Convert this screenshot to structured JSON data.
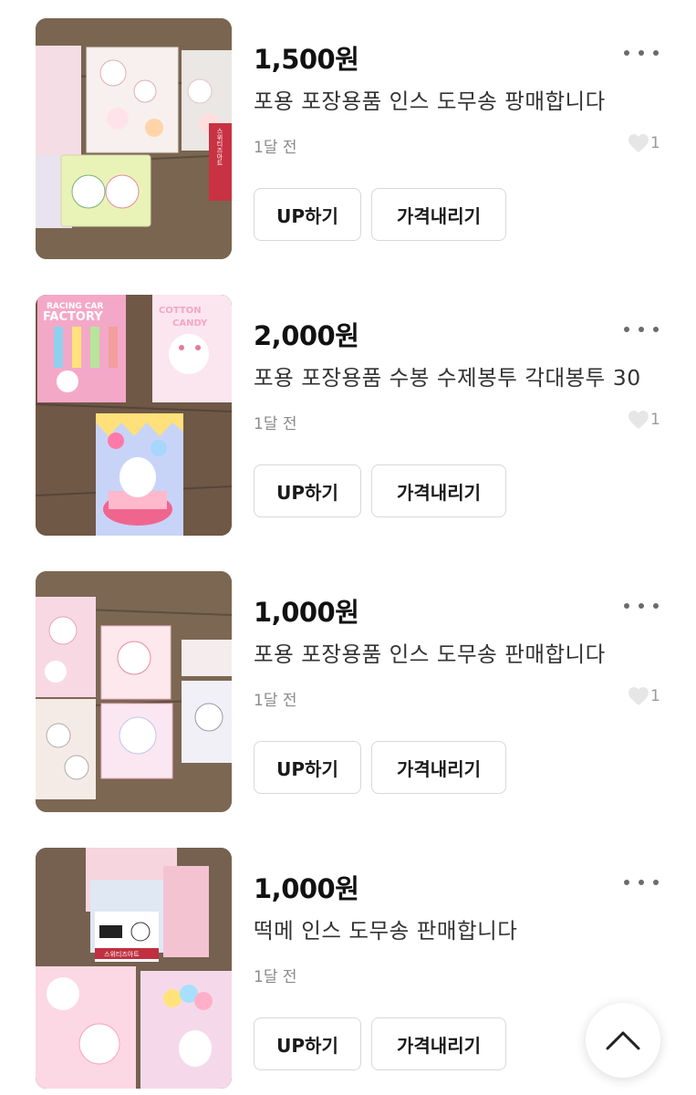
{
  "items": [
    {
      "price": "1,500원",
      "title": "포용 포장용품 인스 도무송 팡매합니다",
      "time": "1달 전",
      "likes": "1",
      "up_label": "UP하기",
      "price_down_label": "가격내리기"
    },
    {
      "price": "2,000원",
      "title": "포용 포장용품 수봉 수제봉투 각대봉투 30",
      "time": "1달 전",
      "likes": "1",
      "up_label": "UP하기",
      "price_down_label": "가격내리기"
    },
    {
      "price": "1,000원",
      "title": "포용 포장용품 인스 도무송 판매합니다",
      "time": "1달 전",
      "likes": "1",
      "up_label": "UP하기",
      "price_down_label": "가격내리기"
    },
    {
      "price": "1,000원",
      "title": "떡메 인스 도무송 판매합니다",
      "time": "1달 전",
      "likes": "",
      "up_label": "UP하기",
      "price_down_label": "가격내리기"
    }
  ],
  "thumb_text": {
    "item1_label": "스위티즈아트",
    "item2_label1": "RACING CAR",
    "item2_label2": "FACTORY",
    "item2_label3": "COTTON",
    "item2_label4": "CANDY",
    "item4_label": "스위티즈아트"
  },
  "icons": {
    "more": "more-dots-icon",
    "like": "heart-icon",
    "scroll_top": "chevron-up-icon"
  },
  "colors": {
    "text": "#1a1a1a",
    "muted": "#8a8a8a",
    "border": "#d8d8d8",
    "heart": "#e6e6e6"
  }
}
